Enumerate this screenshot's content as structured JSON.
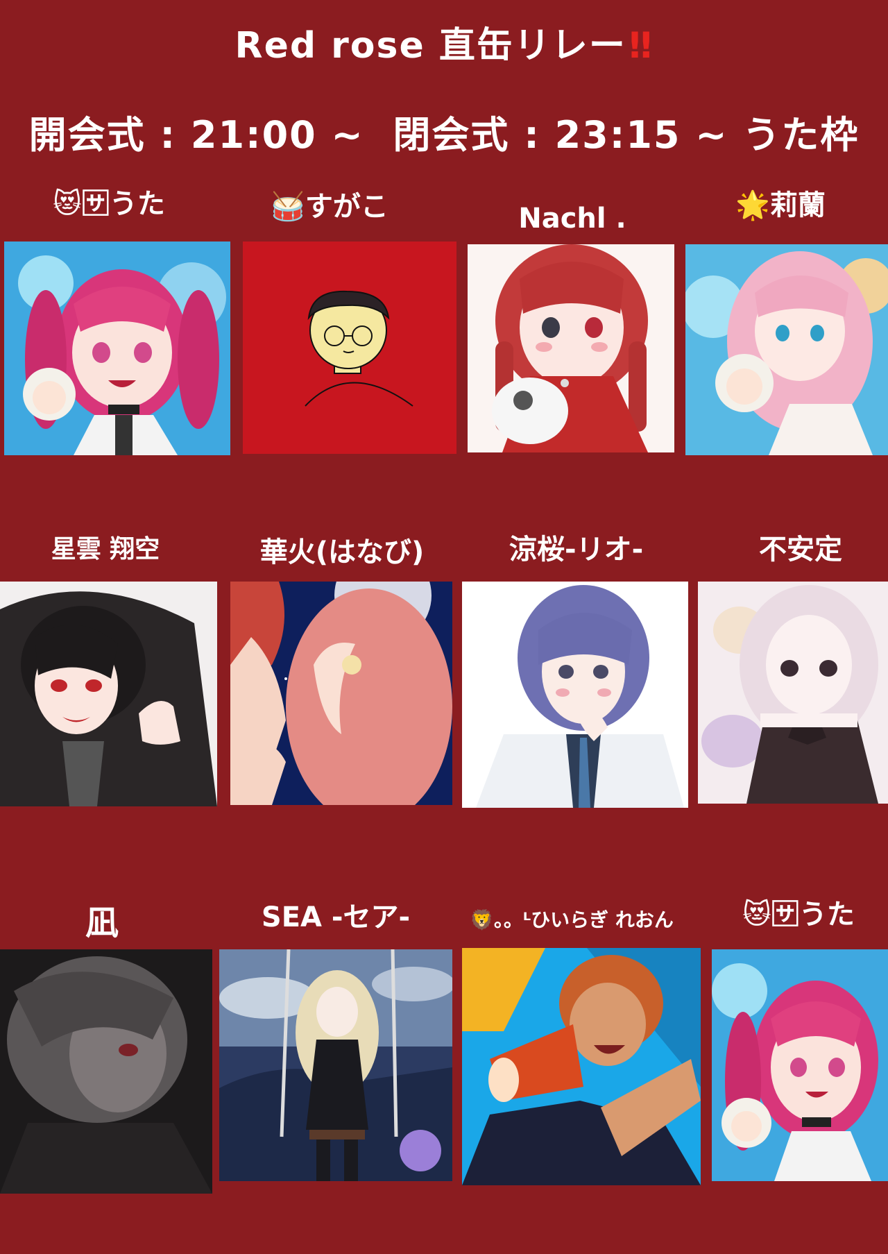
{
  "header": {
    "title": "Red rose  直缶リレー",
    "title_exclamation": "‼",
    "schedule": "開会式 : 21:00 ~  閉会式 : 23:15 ~ うた枠"
  },
  "performers": [
    {
      "name": "😻🈂うた",
      "avatar": "pink-twintail-girl-with-chibi-icon"
    },
    {
      "name": "🥁すがこ",
      "avatar": "glasses-boy-on-red-icon"
    },
    {
      "name": "Nachl .",
      "avatar": "red-braid-girl-with-cat-icon"
    },
    {
      "name": "🌟莉蘭",
      "avatar": "pink-hair-girl-with-chibi-icon"
    },
    {
      "name": "星雲 翔空",
      "avatar": "black-hoodie-boy-icon"
    },
    {
      "name": "華火(はなび)",
      "avatar": "moonlit-couple-icon"
    },
    {
      "name": "涼桜-リオ-",
      "avatar": "purple-hair-boy-icon"
    },
    {
      "name": "不安定",
      "avatar": "white-hair-girl-icon"
    },
    {
      "name": "凪",
      "avatar": "grey-monochrome-boy-icon"
    },
    {
      "name": "SEA -セア-",
      "avatar": "swing-girl-night-sky-icon"
    },
    {
      "name": "🦁。。ᴸひいらぎ れおん",
      "avatar": "megaphone-boy-icon"
    },
    {
      "name": "😻🈂うた",
      "avatar": "pink-twintail-girl-with-chibi-icon"
    }
  ]
}
